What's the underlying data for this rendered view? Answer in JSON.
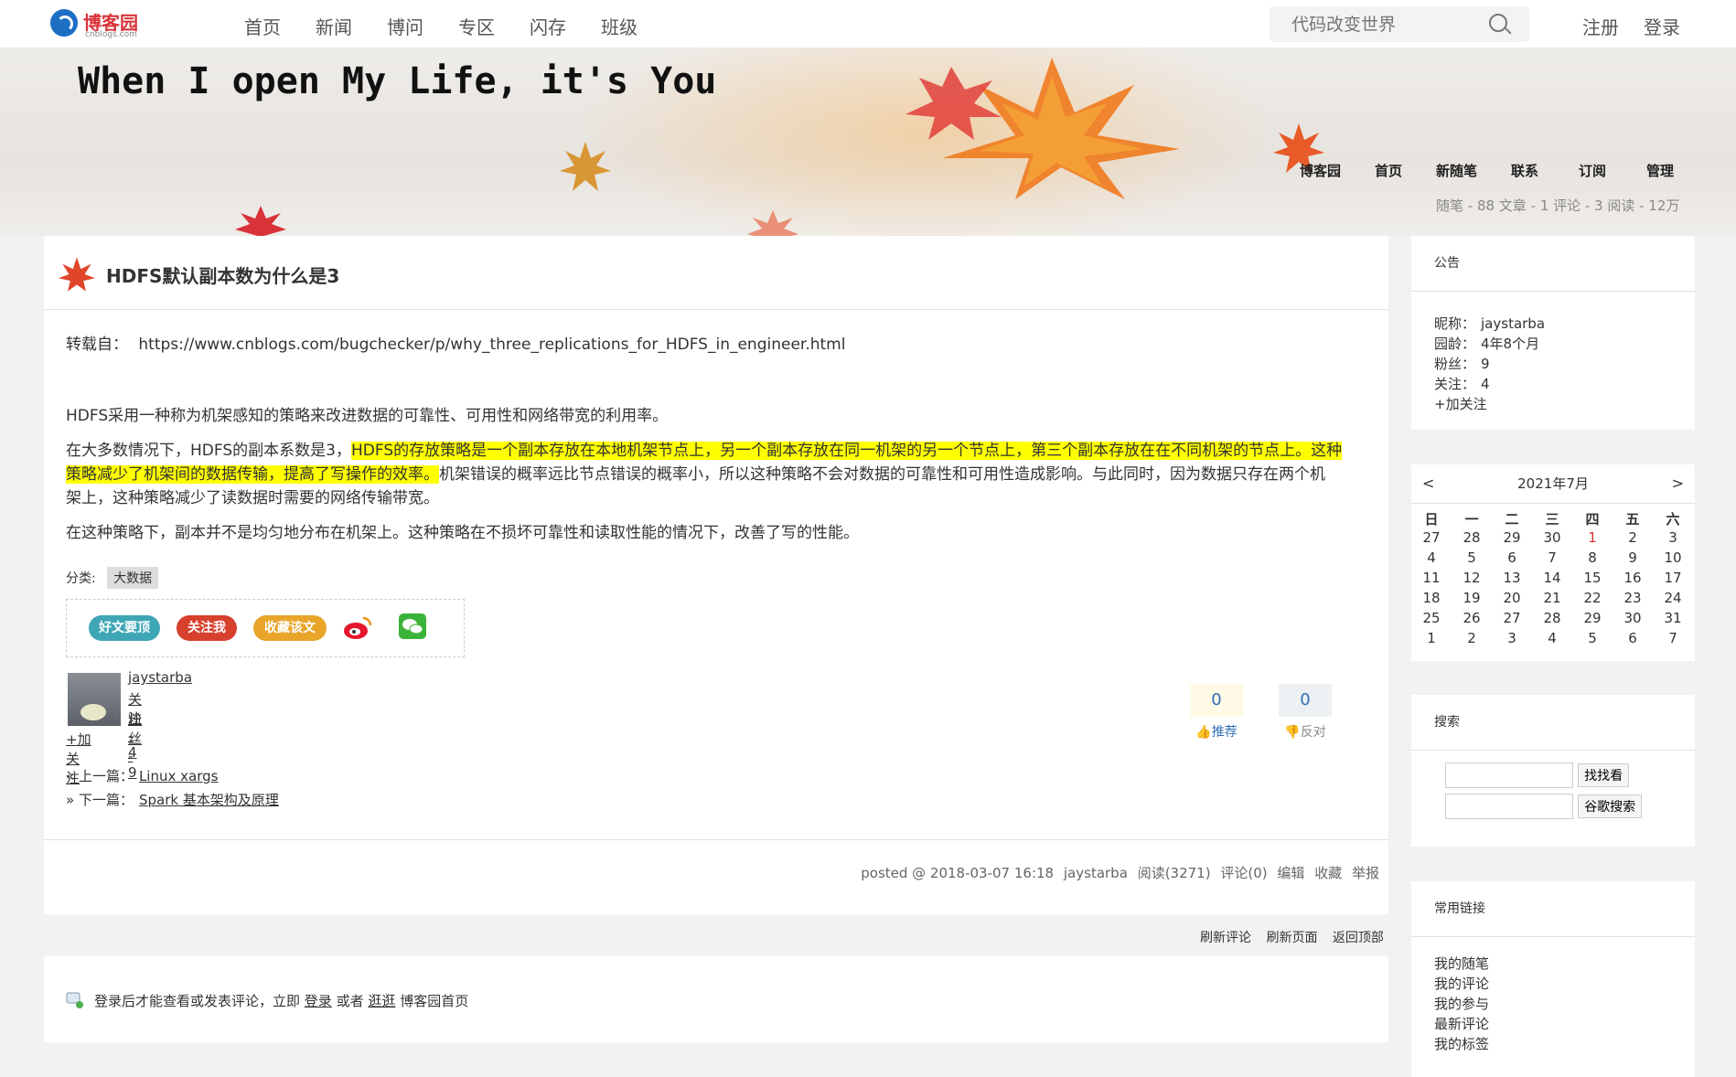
{
  "topnav": {
    "logo_text": "博客园",
    "logo_sub": "cnblogs.com",
    "menu": [
      "首页",
      "新闻",
      "博问",
      "专区",
      "闪存",
      "班级"
    ],
    "search_placeholder": "代码改变世界",
    "register": "注册",
    "login": "登录"
  },
  "header": {
    "blog_title": "When I open My Life, it's You",
    "nav": [
      "博客园",
      "首页",
      "新随笔",
      "联系",
      "订阅",
      "管理"
    ],
    "stats": "随笔 - 88  文章 - 1  评论 - 3  阅读 - 12万"
  },
  "post": {
    "title": "HDFS默认副本数为什么是3",
    "repost_label": "转载自：",
    "repost_url": "https://www.cnblogs.com/bugchecker/p/why_three_replications_for_HDFS_in_engineer.html",
    "p1": "HDFS采用一种称为机架感知的策略来改进数据的可靠性、可用性和网络带宽的利用率。",
    "p2_a": "在大多数情况下，HDFS的副本系数是3，",
    "p2_hl1": "HDFS的存放策略是一个副本存放在本地机架节点上，另一个副本存放在同一机架的另一个节点上，第三个副本存放在在不同机架的节点上。这种",
    "p2_hl2": "策略减少了机架间的数据传输，提高了写操作的效率。",
    "p2_b": "机架错误的概率远比节点错误的概率小，所以这种策略不会对数据的可靠性和可用性造成影响。与此同时，因为数据只存在两个机",
    "p2_c": "架上，这种策略减少了读数据时需要的网络传输带宽。",
    "p3": "在这种策略下，副本并不是均匀地分布在机架上。这种策略在不损坏可靠性和读取性能的情况下，改善了写的性能。",
    "category_label": "分类:",
    "category": "大数据",
    "share": {
      "recommend": "好文要顶",
      "follow": "关注我",
      "favorite": "收藏该文"
    },
    "author": {
      "name": "jaystarba",
      "following": "关注 - 4",
      "followers": "粉丝 - 9",
      "add_follow": "+加关注"
    },
    "digg": {
      "count": "0",
      "label": "推荐"
    },
    "bury": {
      "count": "0",
      "label": "反对"
    },
    "prev_label": "« 上一篇：",
    "prev_link": "Linux xargs",
    "next_label": "» 下一篇：",
    "next_link": "Spark 基本架构及原理",
    "footer": {
      "posted": "posted @ 2018-03-07 16:18",
      "author": "jaystarba",
      "reads": "阅读(3271)",
      "comments": "评论(0)",
      "edit": "编辑",
      "collect": "收藏",
      "report": "举报"
    }
  },
  "refresh": {
    "refresh_comments": "刷新评论",
    "refresh_page": "刷新页面",
    "back_top": "返回顶部"
  },
  "comment": {
    "text1": "登录后才能查看或发表评论，立即",
    "login": "登录",
    "text2": "或者",
    "browse": "逛逛",
    "text3": "博客园首页"
  },
  "sidebar": {
    "notice": {
      "title": "公告",
      "nick_label": "昵称：",
      "nick": "jaystarba",
      "age_label": "园龄：",
      "age": "4年8个月",
      "fans_label": "粉丝：",
      "fans": "9",
      "follow_label": "关注：",
      "follow": "4",
      "add_follow": "+加关注"
    },
    "calendar": {
      "prev": "<",
      "title": "2021年7月",
      "next": ">",
      "weekdays": [
        "日",
        "一",
        "二",
        "三",
        "四",
        "五",
        "六"
      ],
      "weeks": [
        [
          "27",
          "28",
          "29",
          "30",
          "1",
          "2",
          "3"
        ],
        [
          "4",
          "5",
          "6",
          "7",
          "8",
          "9",
          "10"
        ],
        [
          "11",
          "12",
          "13",
          "14",
          "15",
          "16",
          "17"
        ],
        [
          "18",
          "19",
          "20",
          "21",
          "22",
          "23",
          "24"
        ],
        [
          "25",
          "26",
          "27",
          "28",
          "29",
          "30",
          "31"
        ],
        [
          "1",
          "2",
          "3",
          "4",
          "5",
          "6",
          "7"
        ]
      ],
      "today": "1"
    },
    "search": {
      "title": "搜索",
      "btn1": "找找看",
      "btn2": "谷歌搜索"
    },
    "links": {
      "title": "常用链接",
      "items": [
        "我的随笔",
        "我的评论",
        "我的参与",
        "最新评论",
        "我的标签"
      ]
    }
  },
  "colors": {
    "highlight": "#ffff00",
    "today": "#d9333a",
    "digg_bg": "#fffae6",
    "bury_bg": "#eef1f3",
    "digg_text": "#2f6fb5"
  }
}
